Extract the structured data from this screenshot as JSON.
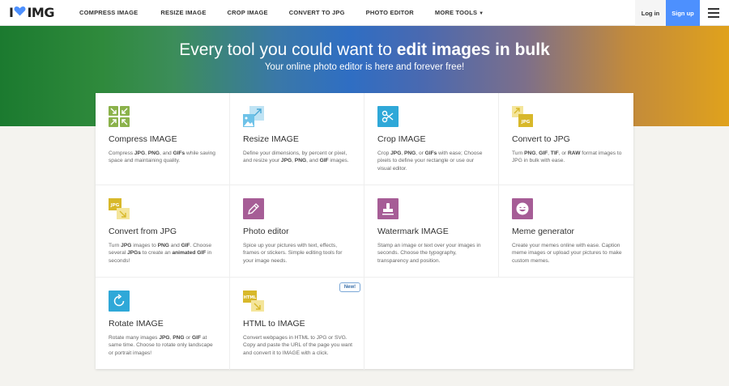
{
  "header": {
    "logo": {
      "left": "I",
      "right": "IMG"
    },
    "nav": [
      {
        "label": "COMPRESS IMAGE"
      },
      {
        "label": "RESIZE IMAGE"
      },
      {
        "label": "CROP IMAGE"
      },
      {
        "label": "CONVERT TO JPG"
      },
      {
        "label": "PHOTO EDITOR"
      },
      {
        "label": "MORE TOOLS"
      }
    ],
    "login": "Log in",
    "signup": "Sign up"
  },
  "hero": {
    "title_pre": "Every tool you could want to ",
    "title_bold": "edit images in bulk",
    "subtitle": "Your online photo editor is here and forever free!"
  },
  "tools": [
    {
      "title": "Compress IMAGE",
      "desc": "Compress <b>JPG</b>, <b>PNG</b>, and <b>GIFs</b> while saving space and maintaining quality."
    },
    {
      "title": "Resize IMAGE",
      "desc": "Define your dimensions, by percent or pixel, and resize your <b>JPG</b>, <b>PNG</b>, and <b>GIF</b> images."
    },
    {
      "title": "Crop IMAGE",
      "desc": "Crop <b>JPG</b>, <b>PNG</b>, or <b>GIFs</b> with ease; Choose pixels to define your rectangle or use our visual editor."
    },
    {
      "title": "Convert to JPG",
      "desc": "Turn <b>PNG</b>, <b>GIF</b>, <b>TIF</b>, or <b>RAW</b> format images to JPG in bulk with ease."
    },
    {
      "title": "Convert from JPG",
      "desc": "Turn <b>JPG</b> images to <b>PNG</b> and <b>GIF</b>. Choose several <b>JPGs</b> to create an <b>animated GIF</b> in seconds!"
    },
    {
      "title": "Photo editor",
      "desc": "Spice up your pictures with text, effects, frames or stickers. Simple editing tools for your image needs."
    },
    {
      "title": "Watermark IMAGE",
      "desc": "Stamp an image or text over your images in seconds. Choose the typography, transparency and position."
    },
    {
      "title": "Meme generator",
      "desc": "Create your memes online with ease. Caption meme images or upload your pictures to make custom memes."
    },
    {
      "title": "Rotate IMAGE",
      "desc": "Rotate many images <b>JPG</b>, <b>PNG</b> or <b>GIF</b> at same time. Choose to rotate only landscape or portrait images!"
    },
    {
      "title": "HTML to IMAGE",
      "desc": "Convert webpages in HTML to JPG or SVG. Copy and paste the URL of the page you want and convert it to IMAGE with a click.",
      "badge": "New!"
    }
  ],
  "icon_labels": {
    "jpg": "JPG",
    "html": "HTML"
  },
  "colors": {
    "compress": "#8bb24b",
    "resize": "#6ec2e8",
    "crop": "#2fa8d8",
    "convert": "#e7c72f",
    "photo_editor": "#a65d96",
    "watermark": "#a65d96",
    "meme": "#a65d96",
    "rotate": "#2fa8d8",
    "html": "#d8b82a",
    "signup": "#4d90fe"
  }
}
